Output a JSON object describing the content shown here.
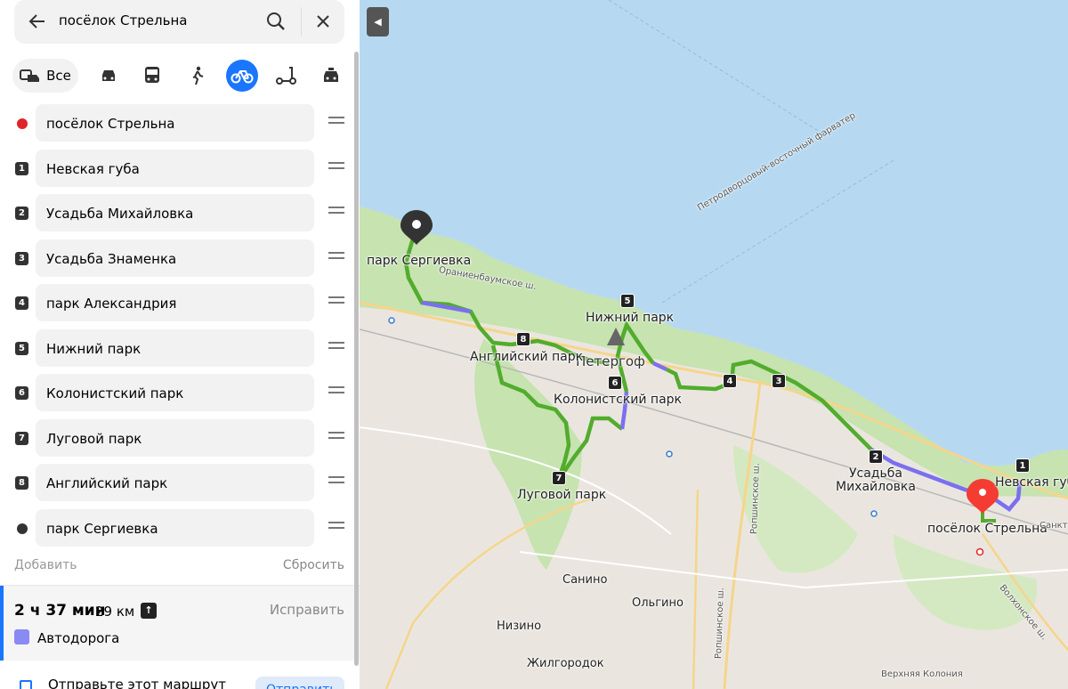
{
  "search": {
    "query": "посёлок Стрельна"
  },
  "modes": {
    "all_label": "Все"
  },
  "stops": [
    {
      "marker": "",
      "label": "посёлок Стрельна"
    },
    {
      "marker": "1",
      "label": "Невская губа"
    },
    {
      "marker": "2",
      "label": "Усадьба Михайловка"
    },
    {
      "marker": "3",
      "label": "Усадьба Знаменка"
    },
    {
      "marker": "4",
      "label": "парк Александрия"
    },
    {
      "marker": "5",
      "label": "Нижний парк"
    },
    {
      "marker": "6",
      "label": "Колонистский парк"
    },
    {
      "marker": "7",
      "label": "Луговой парк"
    },
    {
      "marker": "8",
      "label": "Английский парк"
    },
    {
      "marker": "",
      "label": "парк Сергиевка"
    }
  ],
  "actions": {
    "add": "Добавить",
    "reset": "Сбросить"
  },
  "route": {
    "time": "2 ч 37 мин",
    "distance": "29 км",
    "fix": "Исправить",
    "road": "Автодорога"
  },
  "send": {
    "text": "Отправьте этот маршрут",
    "button": "Отправить"
  },
  "colors": {
    "accent": "#1a75ff",
    "route_green": "#52ac2d",
    "route_blue": "#7b6ff0",
    "start_dot": "#e0252a",
    "end_dot": "#333333"
  },
  "map": {
    "labels": {
      "sergievka": "парк Сергиевка",
      "nizhny": "Нижний парк",
      "petergof": "Петергоф",
      "angliysky": "Английский парк",
      "kolonistsky": "Колонистский парк",
      "lugovoy": "Луговой парк",
      "mikhaylovka_1": "Усадьба",
      "mikhaylovka_2": "Михайловка",
      "nevskaya": "Невская губа",
      "strelna": "посёлок Стрельна",
      "fairway": "Петродворцовый-восточный фарватер",
      "oranienbaumskoe": "Ораниенбаумское ш.",
      "sanino": "Санино",
      "olgino": "Ольгино",
      "nizino": "Низино",
      "zhilgorodok": "Жилгородок",
      "verkhnyaya": "Верхняя Колония",
      "ropsha1": "Ропшинское ш.",
      "ropsha2": "Ропшинское ш.",
      "volkhon": "Волхонское ш.",
      "sankt": "Санкт"
    },
    "markers": [
      "1",
      "2",
      "3",
      "4",
      "5",
      "6",
      "7",
      "8"
    ]
  }
}
